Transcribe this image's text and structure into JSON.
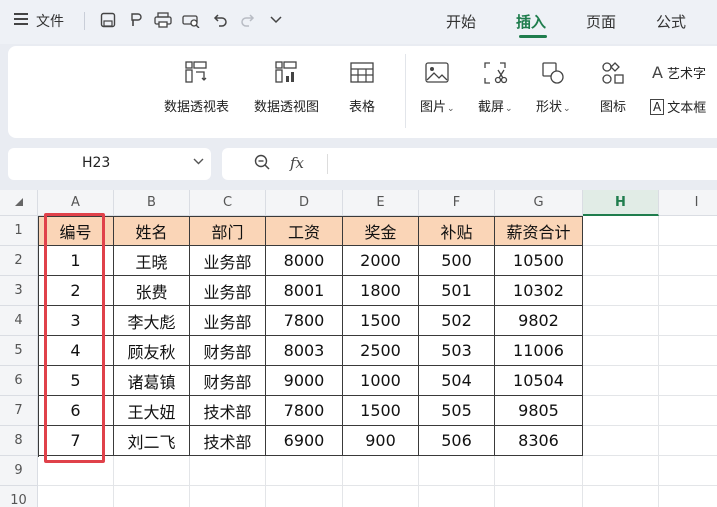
{
  "menubar": {
    "hamburger_icon": "menu-icon",
    "file_label": "文件",
    "quick_access": [
      "save-icon",
      "brush-icon",
      "print-icon",
      "print-preview-icon",
      "undo-icon",
      "redo-icon",
      "dropdown-icon"
    ],
    "tabs": [
      {
        "label": "开始",
        "active": false
      },
      {
        "label": "插入",
        "active": true
      },
      {
        "label": "页面",
        "active": false
      },
      {
        "label": "公式",
        "active": false
      }
    ],
    "accent_color": "#1f7d4d"
  },
  "ribbon": {
    "pivot_table": "数据透视表",
    "pivot_chart": "数据透视图",
    "table": "表格",
    "picture": "图片",
    "screenshot": "截屏",
    "shapes": "形状",
    "icons": "图标",
    "wordart": "艺术字",
    "textbox": "文本框"
  },
  "formula_bar": {
    "name_box": "H23",
    "zoom_icon": "magnifier-icon",
    "fx_label": "fx",
    "value": ""
  },
  "sheet": {
    "columns": [
      "A",
      "B",
      "C",
      "D",
      "E",
      "F",
      "G",
      "H",
      "I"
    ],
    "selected_column": "H",
    "rows": [
      "1",
      "2",
      "3",
      "4",
      "5",
      "6",
      "7",
      "8",
      "9",
      "10"
    ],
    "header_fill": "#fad5b7",
    "highlight_color": "#e0414a",
    "table_header": [
      "编号",
      "姓名",
      "部门",
      "工资",
      "奖金",
      "补贴",
      "薪资合计"
    ],
    "table_rows": [
      [
        "1",
        "王晓",
        "业务部",
        "8000",
        "2000",
        "500",
        "10500"
      ],
      [
        "2",
        "张费",
        "业务部",
        "8001",
        "1800",
        "501",
        "10302"
      ],
      [
        "3",
        "李大彪",
        "业务部",
        "7800",
        "1500",
        "502",
        "9802"
      ],
      [
        "4",
        "顾友秋",
        "财务部",
        "8003",
        "2500",
        "503",
        "11006"
      ],
      [
        "5",
        "诸葛镇",
        "财务部",
        "9000",
        "1000",
        "504",
        "10504"
      ],
      [
        "6",
        "王大妞",
        "技术部",
        "7800",
        "1500",
        "505",
        "9805"
      ],
      [
        "7",
        "刘二飞",
        "技术部",
        "6900",
        "900",
        "506",
        "8306"
      ]
    ]
  }
}
